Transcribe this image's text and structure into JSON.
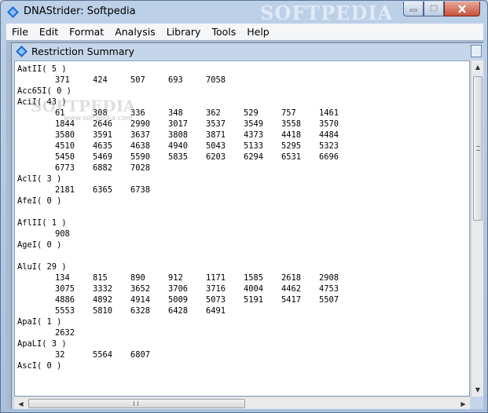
{
  "window": {
    "title": "DNAStrider: Softpedia",
    "watermark": "SOFTPEDIA",
    "colors": {
      "close": "#c7503b",
      "titlebar": "#bcd0e8",
      "accent": "#1f6fd1"
    }
  },
  "menu": [
    "File",
    "Edit",
    "Format",
    "Analysis",
    "Library",
    "Tools",
    "Help"
  ],
  "child": {
    "title": "Restriction Summary",
    "watermark": "SOFTPEDIA",
    "watermark_small": "www.softpedia.com"
  },
  "enzymes": [
    {
      "name": "AatII",
      "count": "5",
      "rows": [
        [
          "371",
          "424",
          "507",
          "693",
          "7058"
        ]
      ]
    },
    {
      "name": "Acc65I",
      "count": "0",
      "rows": []
    },
    {
      "name": "AciI",
      "count": "43",
      "rows": [
        [
          "61",
          "308",
          "336",
          "348",
          "362",
          "529",
          "757",
          "1461"
        ],
        [
          "1844",
          "2646",
          "2990",
          "3017",
          "3537",
          "3549",
          "3558",
          "3570"
        ],
        [
          "3580",
          "3591",
          "3637",
          "3808",
          "3871",
          "4373",
          "4418",
          "4484"
        ],
        [
          "4510",
          "4635",
          "4638",
          "4940",
          "5043",
          "5133",
          "5295",
          "5323"
        ],
        [
          "5450",
          "5469",
          "5590",
          "5835",
          "6203",
          "6294",
          "6531",
          "6696"
        ],
        [
          "6773",
          "6882",
          "7028"
        ]
      ]
    },
    {
      "name": "AclI",
      "count": "3",
      "rows": [
        [
          "2181",
          "6365",
          "6738"
        ]
      ]
    },
    {
      "name": "AfeI",
      "count": "0",
      "rows": [],
      "gap": true
    },
    {
      "name": "AflII",
      "count": "1",
      "rows": [
        [
          "908"
        ]
      ]
    },
    {
      "name": "AgeI",
      "count": "0",
      "rows": [],
      "gap": true
    },
    {
      "name": "AluI",
      "count": "29",
      "rows": [
        [
          "134",
          "815",
          "890",
          "912",
          "1171",
          "1585",
          "2618",
          "2908"
        ],
        [
          "3075",
          "3332",
          "3652",
          "3706",
          "3716",
          "4004",
          "4462",
          "4753"
        ],
        [
          "4886",
          "4892",
          "4914",
          "5009",
          "5073",
          "5191",
          "5417",
          "5507"
        ],
        [
          "5553",
          "5810",
          "6328",
          "6428",
          "6491"
        ]
      ]
    },
    {
      "name": "ApaI",
      "count": "1",
      "rows": [
        [
          "2632"
        ]
      ]
    },
    {
      "name": "ApaLI",
      "count": "3",
      "rows": [
        [
          "32",
          "5564",
          "6807"
        ]
      ]
    },
    {
      "name": "AscI",
      "count": "0",
      "rows": []
    }
  ]
}
